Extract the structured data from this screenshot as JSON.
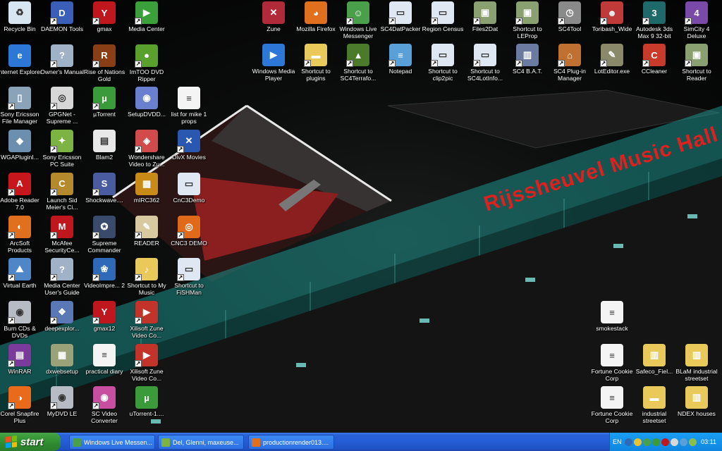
{
  "desktop": {
    "icons": [
      {
        "label": "Recycle Bin",
        "icon": "recycle-bin-icon",
        "color": "#d8e6f2",
        "glyph": "♻",
        "shortcut": false
      },
      {
        "label": "DAEMON Tools",
        "icon": "daemon-tools-icon",
        "color": "#3b5fb8",
        "glyph": "D",
        "shortcut": true
      },
      {
        "label": "gmax",
        "icon": "gmax-icon",
        "color": "#c0161d",
        "glyph": "Y",
        "shortcut": true
      },
      {
        "label": "Media Center",
        "icon": "media-center-icon",
        "color": "#3aa13a",
        "glyph": "▶",
        "shortcut": true
      },
      {
        "label": "Internet Explorer",
        "icon": "internet-explorer-icon",
        "color": "#2d78d6",
        "glyph": "e",
        "shortcut": false
      },
      {
        "label": "Owner's Manual",
        "icon": "manual-icon",
        "color": "#9fb2c8",
        "glyph": "?",
        "shortcut": true
      },
      {
        "label": "Rise of Nations Gold",
        "icon": "rise-of-nations-icon",
        "color": "#8a3e16",
        "glyph": "R",
        "shortcut": true
      },
      {
        "label": "ImTOO DVD Ripper",
        "icon": "dvd-ripper-icon",
        "color": "#5aa02c",
        "glyph": "●",
        "shortcut": true
      },
      {
        "label": "Sony Ericsson File Manager",
        "icon": "phone-icon",
        "color": "#8aa3b8",
        "glyph": "▯",
        "shortcut": true
      },
      {
        "label": "GPGNet - Supreme ...",
        "icon": "gpgnet-icon",
        "color": "#d7d7d7",
        "glyph": "◎",
        "shortcut": true
      },
      {
        "label": "µTorrent",
        "icon": "utorrent-icon",
        "color": "#3b9b3b",
        "glyph": "µ",
        "shortcut": true
      },
      {
        "label": "SetupDVDD...",
        "icon": "setup-disc-icon",
        "color": "#6b7fd0",
        "glyph": "◉",
        "shortcut": false
      },
      {
        "label": "list for mike 1 props",
        "icon": "text-document-icon",
        "color": "#f4f4f4",
        "glyph": "≡",
        "shortcut": false
      },
      {
        "label": "WGAPluginI...",
        "icon": "wga-plugin-icon",
        "color": "#6c8fb0",
        "glyph": "◆",
        "shortcut": false
      },
      {
        "label": "Sony Ericsson PC Suite",
        "icon": "pc-suite-icon",
        "color": "#7cb342",
        "glyph": "✦",
        "shortcut": true
      },
      {
        "label": "Blam2",
        "icon": "blam-icon",
        "color": "#e8e8e8",
        "glyph": "▤",
        "shortcut": false
      },
      {
        "label": "Wondershare Video to Zu...",
        "icon": "wondershare-icon",
        "color": "#d24a4a",
        "glyph": "◈",
        "shortcut": true
      },
      {
        "label": "DivX Movies",
        "icon": "divx-icon",
        "color": "#2a58b0",
        "glyph": "✕",
        "shortcut": true
      },
      {
        "label": "Adobe Reader 7.0",
        "icon": "adobe-reader-icon",
        "color": "#c8161d",
        "glyph": "A",
        "shortcut": true
      },
      {
        "label": "Launch Sid Meier's Ci...",
        "icon": "civilization-icon",
        "color": "#b58a2c",
        "glyph": "C",
        "shortcut": true
      },
      {
        "label": "Shockwave....",
        "icon": "shockwave-icon",
        "color": "#4a5ba0",
        "glyph": "S",
        "shortcut": true
      },
      {
        "label": "mIRC362",
        "icon": "archive-icon",
        "color": "#c98a18",
        "glyph": "▦",
        "shortcut": false
      },
      {
        "label": "CnC3Demo",
        "icon": "window-icon",
        "color": "#dfe7f2",
        "glyph": "▭",
        "shortcut": false
      },
      {
        "label": "ArcSoft Products",
        "icon": "arcsoft-icon",
        "color": "#e0701e",
        "glyph": "◐",
        "shortcut": true
      },
      {
        "label": "McAfee SecurityCe...",
        "icon": "mcafee-icon",
        "color": "#c0161d",
        "glyph": "M",
        "shortcut": true
      },
      {
        "label": "Supreme Commander",
        "icon": "supreme-commander-icon",
        "color": "#3a4a6a",
        "glyph": "✪",
        "shortcut": true
      },
      {
        "label": "READER",
        "icon": "reader-icon",
        "color": "#d9c9a0",
        "glyph": "✎",
        "shortcut": true
      },
      {
        "label": "CNC3 DEMO",
        "icon": "cnc3-icon",
        "color": "#e06a1a",
        "glyph": "◎",
        "shortcut": true
      },
      {
        "label": "Virtual Earth",
        "icon": "virtual-earth-icon",
        "color": "#4f86c7",
        "glyph": "⛰",
        "shortcut": true
      },
      {
        "label": "Media Center User's Guide",
        "icon": "guide-icon",
        "color": "#9fb2c8",
        "glyph": "?",
        "shortcut": true
      },
      {
        "label": "VideoImpre... 2",
        "icon": "video-impression-icon",
        "color": "#2f6ab8",
        "glyph": "❀",
        "shortcut": true
      },
      {
        "label": "Shortcut to My Music",
        "icon": "folder-icon",
        "color": "#e9c95a",
        "glyph": "♪",
        "shortcut": true
      },
      {
        "label": "Shortcut to FiSHMan",
        "icon": "window-icon",
        "color": "#dfe7f2",
        "glyph": "▭",
        "shortcut": true
      },
      {
        "label": "Burn CDs & DVDs",
        "icon": "burn-disc-icon",
        "color": "#b7bcc4",
        "glyph": "◉",
        "shortcut": true
      },
      {
        "label": "deepexplor...",
        "icon": "deepexploration-icon",
        "color": "#5a78b5",
        "glyph": "❖",
        "shortcut": true
      },
      {
        "label": "gmax12",
        "icon": "gmax-icon",
        "color": "#c0161d",
        "glyph": "Y",
        "shortcut": true
      },
      {
        "label": "Xilisoft Zune Video Co...",
        "icon": "xilisoft-icon",
        "color": "#c2342a",
        "glyph": "▶",
        "shortcut": true
      },
      {
        "label": "WinRAR",
        "icon": "winrar-icon",
        "color": "#7a3b9c",
        "glyph": "▤",
        "shortcut": true
      },
      {
        "label": "dxwebsetup",
        "icon": "dxwebsetup-icon",
        "color": "#9aa27a",
        "glyph": "▦",
        "shortcut": false
      },
      {
        "label": "practical diary",
        "icon": "text-document-icon",
        "color": "#f4f4f4",
        "glyph": "≡",
        "shortcut": false
      },
      {
        "label": "Xilisoft Zune Video Co...",
        "icon": "xilisoft-icon",
        "color": "#c2342a",
        "glyph": "▶",
        "shortcut": true
      },
      {
        "label": "Corel Snapfire Plus",
        "icon": "corel-icon",
        "color": "#e86a1a",
        "glyph": "◑",
        "shortcut": true
      },
      {
        "label": "MyDVD LE",
        "icon": "mydvd-icon",
        "color": "#b7bcc4",
        "glyph": "◉",
        "shortcut": true
      },
      {
        "label": "SC Video Converter",
        "icon": "video-converter-icon",
        "color": "#c84fa0",
        "glyph": "◉",
        "shortcut": true
      },
      {
        "label": "uTorrent-1....",
        "icon": "utorrent-icon",
        "color": "#3b9b3b",
        "glyph": "µ",
        "shortcut": false
      },
      {
        "label": "Zune",
        "icon": "zune-icon",
        "color": "#b02a3a",
        "glyph": "✕",
        "shortcut": false
      },
      {
        "label": "Mozilla Firefox",
        "icon": "firefox-icon",
        "color": "#e0701e",
        "glyph": "◕",
        "shortcut": false
      },
      {
        "label": "Windows Live Messenger",
        "icon": "messenger-icon",
        "color": "#4aa04a",
        "glyph": "☺",
        "shortcut": true
      },
      {
        "label": "SC4DatPacker",
        "icon": "window-icon",
        "color": "#dfe7f2",
        "glyph": "▭",
        "shortcut": true
      },
      {
        "label": "Region Census",
        "icon": "window-icon",
        "color": "#dfe7f2",
        "glyph": "▭",
        "shortcut": true
      },
      {
        "label": "Files2Dat",
        "icon": "files2dat-icon",
        "color": "#8aa070",
        "glyph": "▣",
        "shortcut": true
      },
      {
        "label": "Shortcut to LEProp",
        "icon": "leprop-icon",
        "color": "#8aa070",
        "glyph": "▣",
        "shortcut": true
      },
      {
        "label": "SC4Tool",
        "icon": "sc4tool-icon",
        "color": "#8a8a8a",
        "glyph": "◷",
        "shortcut": true
      },
      {
        "label": "Toribash_Wide",
        "icon": "toribash-icon",
        "color": "#c03a3a",
        "glyph": "☻",
        "shortcut": true
      },
      {
        "label": "Autodesk 3ds Max 9 32-bit",
        "icon": "3ds-max-icon",
        "color": "#1e6a6a",
        "glyph": "3",
        "shortcut": true
      },
      {
        "label": "SimCity 4 Deluxe",
        "icon": "simcity4-icon",
        "color": "#7a4aa8",
        "glyph": "4",
        "shortcut": true
      },
      {
        "label": "Windows Media Player",
        "icon": "media-player-icon",
        "color": "#2d78d6",
        "glyph": "▶",
        "shortcut": false
      },
      {
        "label": "Shortcut to plugins",
        "icon": "folder-icon",
        "color": "#e9c95a",
        "glyph": "▬",
        "shortcut": true
      },
      {
        "label": "Shortcut to SC4Terrafo...",
        "icon": "terraformer-icon",
        "color": "#4a7a2a",
        "glyph": "▲",
        "shortcut": true
      },
      {
        "label": "Notepad",
        "icon": "notepad-icon",
        "color": "#5aa0d8",
        "glyph": "≡",
        "shortcut": true
      },
      {
        "label": "Shortcut to clip2pic",
        "icon": "window-icon",
        "color": "#dfe7f2",
        "glyph": "▭",
        "shortcut": true
      },
      {
        "label": "Shortcut to SC4LotInfo...",
        "icon": "window-icon",
        "color": "#dfe7f2",
        "glyph": "▭",
        "shortcut": true
      },
      {
        "label": "SC4 B.A.T.",
        "icon": "bat-icon",
        "color": "#6a7aa0",
        "glyph": "▥",
        "shortcut": true
      },
      {
        "label": "SC4 Plug-in Manager",
        "icon": "plugin-manager-icon",
        "color": "#c07030",
        "glyph": "⌂",
        "shortcut": true
      },
      {
        "label": "LotEditor.exe",
        "icon": "lot-editor-icon",
        "color": "#8a8a6a",
        "glyph": "✎",
        "shortcut": true
      },
      {
        "label": "CCleaner",
        "icon": "ccleaner-icon",
        "color": "#c83a2a",
        "glyph": "C",
        "shortcut": true
      },
      {
        "label": "Shortcut to Reader",
        "icon": "reader-icon",
        "color": "#8aa070",
        "glyph": "▣",
        "shortcut": true
      },
      {
        "label": "smokestack",
        "icon": "text-document-icon",
        "color": "#f4f4f4",
        "glyph": "≡",
        "shortcut": false
      },
      {
        "label": "Fortune Cookie Corp",
        "icon": "text-document-icon",
        "color": "#f4f4f4",
        "glyph": "≡",
        "shortcut": false
      },
      {
        "label": "Safeco_Fiel...",
        "icon": "zip-folder-icon",
        "color": "#e9c95a",
        "glyph": "▥",
        "shortcut": false
      },
      {
        "label": "BLaM industrial streetset",
        "icon": "zip-folder-icon",
        "color": "#e9c95a",
        "glyph": "▥",
        "shortcut": false
      },
      {
        "label": "Fortune Cookie Corp",
        "icon": "text-document-icon",
        "color": "#f4f4f4",
        "glyph": "≡",
        "shortcut": false
      },
      {
        "label": "industrial streetset",
        "icon": "folder-icon",
        "color": "#e9c95a",
        "glyph": "▬",
        "shortcut": false
      },
      {
        "label": "NDEX houses",
        "icon": "zip-folder-icon",
        "color": "#e9c95a",
        "glyph": "▥",
        "shortcut": false
      }
    ]
  },
  "wallpaper": {
    "sign_text": "Rijssheuvel Music Hall",
    "sign_color": "#e0201e",
    "glass_color": "#1d8f8a"
  },
  "taskbar": {
    "start_label": "start",
    "tasks": [
      {
        "label": "Windows Live Messen...",
        "icon": "messenger-icon",
        "color": "#4aa04a"
      },
      {
        "label": "Del, Glenni, maxeuse...",
        "icon": "messenger-chat-icon",
        "color": "#7cb342"
      },
      {
        "label": "productionrender013....",
        "icon": "firefox-icon",
        "color": "#e0701e"
      }
    ],
    "tray": {
      "language": "EN",
      "clock": "03:11",
      "icons": [
        {
          "icon": "network-icon",
          "color": "#2f6ab8"
        },
        {
          "icon": "shield-icon",
          "color": "#e6c230"
        },
        {
          "icon": "messenger-tray-icon",
          "color": "#4aa04a"
        },
        {
          "icon": "utorrent-tray-icon",
          "color": "#3b9b3b"
        },
        {
          "icon": "security-tray-icon",
          "color": "#c0161d"
        },
        {
          "icon": "speaker-icon",
          "color": "#d8d8d8"
        },
        {
          "icon": "display-icon",
          "color": "#5aa0d8"
        },
        {
          "icon": "sync-icon",
          "color": "#8ac04a"
        }
      ]
    }
  }
}
